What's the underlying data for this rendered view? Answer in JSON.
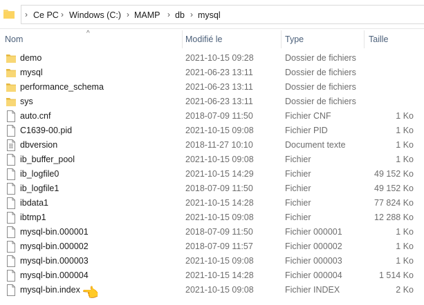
{
  "address": {
    "crumbs": [
      "Ce PC",
      "Windows (C:)",
      "MAMP",
      "db",
      "mysql"
    ],
    "separator": "›"
  },
  "columns": {
    "name": "Nom",
    "modified": "Modifié le",
    "type": "Type",
    "size": "Taille"
  },
  "files": [
    {
      "kind": "folder",
      "name": "demo",
      "date": "2021-10-15 09:28",
      "type": "Dossier de fichiers",
      "size": ""
    },
    {
      "kind": "folder",
      "name": "mysql",
      "date": "2021-06-23 13:11",
      "type": "Dossier de fichiers",
      "size": ""
    },
    {
      "kind": "folder",
      "name": "performance_schema",
      "date": "2021-06-23 13:11",
      "type": "Dossier de fichiers",
      "size": ""
    },
    {
      "kind": "folder",
      "name": "sys",
      "date": "2021-06-23 13:11",
      "type": "Dossier de fichiers",
      "size": ""
    },
    {
      "kind": "file",
      "name": "auto.cnf",
      "date": "2018-07-09 11:50",
      "type": "Fichier CNF",
      "size": "1 Ko"
    },
    {
      "kind": "file",
      "name": "C1639-00.pid",
      "date": "2021-10-15 09:08",
      "type": "Fichier PID",
      "size": "1 Ko"
    },
    {
      "kind": "text",
      "name": "dbversion",
      "date": "2018-11-27 10:10",
      "type": "Document texte",
      "size": "1 Ko"
    },
    {
      "kind": "file",
      "name": "ib_buffer_pool",
      "date": "2021-10-15 09:08",
      "type": "Fichier",
      "size": "1 Ko"
    },
    {
      "kind": "file",
      "name": "ib_logfile0",
      "date": "2021-10-15 14:29",
      "type": "Fichier",
      "size": "49 152 Ko"
    },
    {
      "kind": "file",
      "name": "ib_logfile1",
      "date": "2018-07-09 11:50",
      "type": "Fichier",
      "size": "49 152 Ko"
    },
    {
      "kind": "file",
      "name": "ibdata1",
      "date": "2021-10-15 14:28",
      "type": "Fichier",
      "size": "77 824 Ko"
    },
    {
      "kind": "file",
      "name": "ibtmp1",
      "date": "2021-10-15 09:08",
      "type": "Fichier",
      "size": "12 288 Ko"
    },
    {
      "kind": "file",
      "name": "mysql-bin.000001",
      "date": "2018-07-09 11:50",
      "type": "Fichier 000001",
      "size": "1 Ko"
    },
    {
      "kind": "file",
      "name": "mysql-bin.000002",
      "date": "2018-07-09 11:57",
      "type": "Fichier 000002",
      "size": "1 Ko"
    },
    {
      "kind": "file",
      "name": "mysql-bin.000003",
      "date": "2021-10-15 09:08",
      "type": "Fichier 000003",
      "size": "1 Ko"
    },
    {
      "kind": "file",
      "name": "mysql-bin.000004",
      "date": "2021-10-15 14:28",
      "type": "Fichier 000004",
      "size": "1 514 Ko"
    },
    {
      "kind": "file",
      "name": "mysql-bin.index",
      "date": "2021-10-15 09:08",
      "type": "Fichier INDEX",
      "size": "2 Ko"
    }
  ],
  "pointer_icon": "backhand-index-pointing-left-icon",
  "colors": {
    "folder": "#f8d775",
    "folder_dark": "#e5b73f",
    "header_text": "#4c607a",
    "meta_text": "#6d6d6d"
  }
}
